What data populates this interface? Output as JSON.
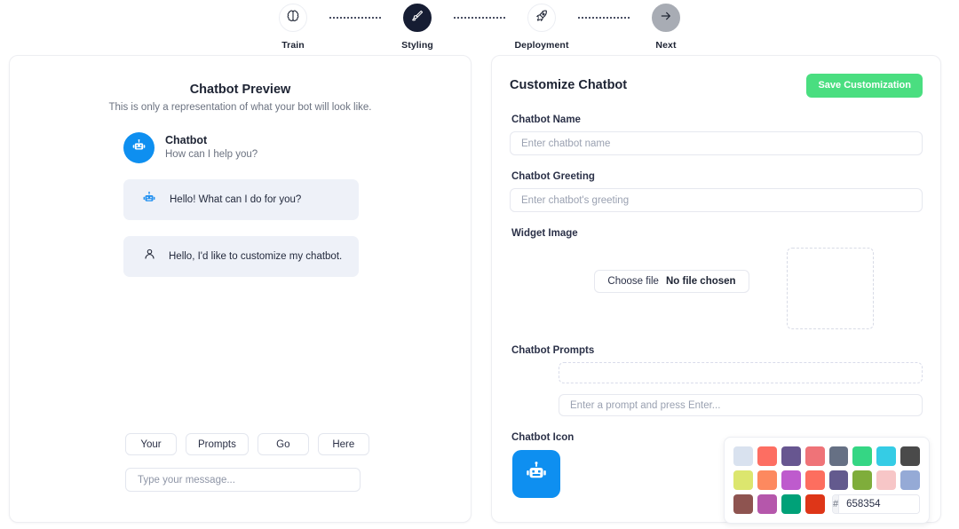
{
  "stepper": {
    "steps": [
      {
        "label": "Train",
        "icon": "brain-icon",
        "state": "done"
      },
      {
        "label": "Styling",
        "icon": "paintbrush-icon",
        "state": "active"
      },
      {
        "label": "Deployment",
        "icon": "rocket-icon",
        "state": "upcoming"
      },
      {
        "label": "Next",
        "icon": "arrow-right-icon",
        "state": "next"
      }
    ]
  },
  "preview": {
    "title": "Chatbot Preview",
    "subtitle": "This is only a representation of what your bot will look like.",
    "bot_name": "Chatbot",
    "bot_greeting": "How can I help you?",
    "avatar_color": "#0e8ff0",
    "messages": [
      {
        "role": "bot",
        "icon": "robot-icon",
        "text": "Hello! What can I do for you?"
      },
      {
        "role": "user",
        "icon": "user-icon",
        "text": "Hello, I'd like to customize my chatbot."
      }
    ],
    "quick_prompts": [
      "Your",
      "Prompts",
      "Go",
      "Here"
    ],
    "message_placeholder": "Type your message..."
  },
  "customize": {
    "title": "Customize Chatbot",
    "save_label": "Save Customization",
    "save_color": "#4ade80",
    "name_label": "Chatbot Name",
    "name_value": "",
    "name_placeholder": "Enter chatbot name",
    "greeting_label": "Chatbot Greeting",
    "greeting_value": "",
    "greeting_placeholder": "Enter chatbot's greeting",
    "widget_image_label": "Widget Image",
    "choose_file_label": "Choose file",
    "no_file_label": "No file chosen",
    "prompts_label": "Chatbot Prompts",
    "prompt_value": "",
    "prompt_placeholder": "Enter a prompt and press Enter...",
    "icon_label": "Chatbot Icon",
    "icon_color": "#0e8ff0",
    "icon_name": "robot-icon"
  },
  "color_picker": {
    "row1": [
      "#d9e2ef",
      "#fd6e62",
      "#675690",
      "#ef7378",
      "#667084",
      "#35d684",
      "#35cce5",
      "#4a4a4a"
    ],
    "row2": [
      "#dce66e",
      "#fd895f",
      "#be5bcd",
      "#fd6e5f",
      "#635a8e",
      "#7fad3b",
      "#f7c6c7",
      "#95aad6"
    ],
    "row3": [
      "#8e5450",
      "#b557ab",
      "#00a178",
      "#de3618"
    ],
    "hash_symbol": "#",
    "hex_value": "658354"
  }
}
